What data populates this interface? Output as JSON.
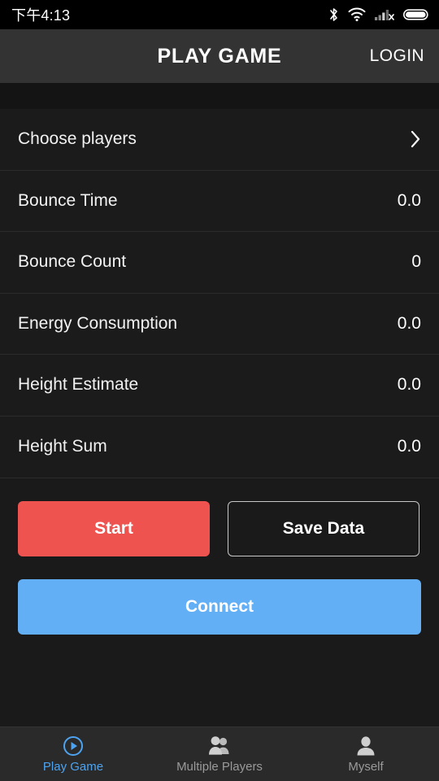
{
  "status_bar": {
    "time": "下午4:13",
    "icons": [
      "bluetooth-icon",
      "wifi-icon",
      "cellular-signal-no-sim-icon",
      "battery-icon"
    ]
  },
  "header": {
    "title": "PLAY GAME",
    "login_label": "LOGIN"
  },
  "list": {
    "chooser": {
      "label": "Choose players",
      "icon": "chevron-right-icon"
    },
    "rows": [
      {
        "label": "Bounce Time",
        "value": "0.0"
      },
      {
        "label": "Bounce Count",
        "value": "0"
      },
      {
        "label": "Energy Consumption",
        "value": "0.0"
      },
      {
        "label": "Height Estimate",
        "value": "0.0"
      },
      {
        "label": "Height Sum",
        "value": "0.0"
      }
    ]
  },
  "actions": {
    "start_label": "Start",
    "save_label": "Save Data",
    "connect_label": "Connect"
  },
  "bottom_nav": {
    "items": [
      {
        "label": "Play Game",
        "icon": "play-circle-icon",
        "active": true
      },
      {
        "label": "Multiple Players",
        "icon": "people-group-icon",
        "active": false
      },
      {
        "label": "Myself",
        "icon": "person-icon",
        "active": false
      }
    ]
  },
  "colors": {
    "accent_blue": "#63aff6",
    "start_red": "#ef5350",
    "nav_active": "#4da3f0",
    "header_bg": "#333333",
    "page_bg": "#1a1a1a",
    "row_bg": "#1b1b1b"
  }
}
